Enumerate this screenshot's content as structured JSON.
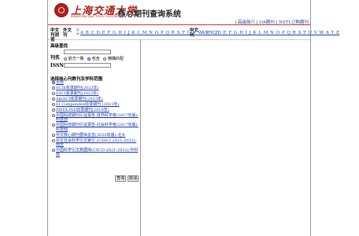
{
  "header": {
    "brand_cn": "上海交通大学",
    "brand_en": "SHANGHAI JIAO TONG UNIVERSITY",
    "system_title": "核心期刊查询系统",
    "links": [
      "高级简介",
      "OA期刊",
      "NSTL订购期刊"
    ]
  },
  "alpha": {
    "zh_label": "中文刊浏览",
    "foreign_label": "外文刊",
    "num_label": "0-9",
    "letters_left": "A B C D E F G H I J K L M N O P Q R S T U V W X Y Z",
    "zh_label2": "中文刊",
    "letters_right": "A B C D E F G H I J K L M N O P Q R S T U V W X Y Z"
  },
  "search": {
    "section_title": "高级查找",
    "title_label": "刊名",
    "issn_label": "ISSN",
    "match_options": [
      "前方一致",
      "包含",
      "精确匹配"
    ],
    "selected_match": "包含",
    "category_title": "选择核心刊数刊及学科范围",
    "categories": [
      "全部",
      "SCIE收录期刊(2023年)",
      "SSCI收录期刊(2023年)",
      "A&HCI收录期刊(2023年)",
      "EI Compendex收录期刊 (2023年)",
      "MEDLINE收录期刊(2018年)",
      "中国科技期刊引证报告-自然科学卷(2017年版)-科技部",
      "中国科技期刊引证报告-社会科学卷(2017年版)-科技部",
      "中文核心期刊要目总览(2020年版)-北大",
      "中文社会科学引文索引 (CSSCI 2021-2022)-南大",
      "中国科学引文数据库(CSCD 2021-2022)-中科院"
    ],
    "selected_category": "全部",
    "search_button": "查询",
    "cancel_button": "取消"
  }
}
